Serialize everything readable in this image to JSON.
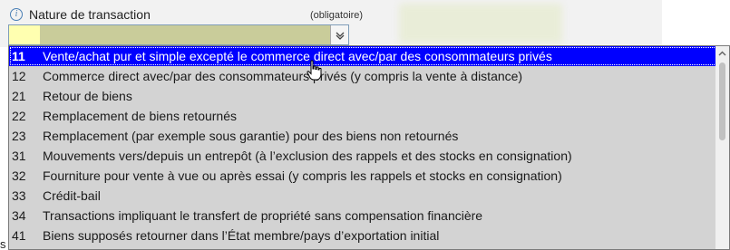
{
  "field": {
    "label": "Nature de transaction",
    "required_note": "(obligatoire)",
    "info_icon_glyph": "i"
  },
  "dropdown": {
    "selected_index": 0,
    "options": [
      {
        "code": "11",
        "label": "Vente/achat pur et simple excepté le commerce direct avec/par des consommateurs privés"
      },
      {
        "code": "12",
        "label": "Commerce direct avec/par des consommateurs privés (y compris la vente à distance)"
      },
      {
        "code": "21",
        "label": "Retour de biens"
      },
      {
        "code": "22",
        "label": "Remplacement de biens retournés"
      },
      {
        "code": "23",
        "label": "Remplacement (par exemple sous garantie) pour des biens non retournés"
      },
      {
        "code": "31",
        "label": "Mouvements vers/depuis un entrepôt (à l’exclusion des rappels et des stocks en consignation)"
      },
      {
        "code": "32",
        "label": "Fourniture pour vente à vue ou après essai (y compris les rappels et stocks en consignation)"
      },
      {
        "code": "33",
        "label": "Crédit-bail"
      },
      {
        "code": "34",
        "label": "Transactions impliquant le transfert de propriété sans compensation financière"
      },
      {
        "code": "41",
        "label": "Biens supposés retourner dans l’État membre/pays d’exportation initial"
      }
    ]
  },
  "colors": {
    "selection": "#0000ff",
    "list_background": "#d3d3d3",
    "select_fill": "#c9cc9a",
    "select_value_fill": "#ffffb0"
  },
  "icons": {
    "info": "info-icon",
    "arrow": "chevron-down-icon",
    "cursor": "hand-pointer-icon",
    "scroll_up": "chevron-up-icon"
  },
  "edge_text": "s"
}
